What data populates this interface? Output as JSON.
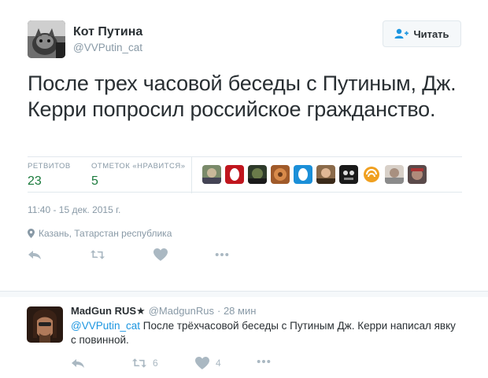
{
  "tweet": {
    "author_name": "Кот Путина",
    "author_handle": "@VVPutin_cat",
    "follow_label": "Читать",
    "text": "После трех часовой беседы с Путиным, Дж. Керри попросил российское гражданство.",
    "stats": {
      "retweets_label": "РЕТВИТОВ",
      "retweets_value": "23",
      "likes_label": "ОТМЕТОК «НРАВИТСЯ»",
      "likes_value": "5"
    },
    "timestamp": "11:40 - 15 дек. 2015 г.",
    "location": "Казань, Татарстан республика"
  },
  "reply": {
    "author_name": "MadGun RUS★",
    "author_handle": "@MadgunRus",
    "time": "· 28 мин",
    "mention": "@VVPutin_cat",
    "text": " После трёхчасовой беседы с Путиным Дж. Керри написал явку с повинной.",
    "retweet_count": "6",
    "like_count": "4"
  },
  "colors": {
    "accent": "#1b95e0",
    "stat_value": "#1a7a3c",
    "muted": "#8899a6",
    "icon": "#aab8c2"
  },
  "icons": [
    "follow-icon",
    "location-pin-icon",
    "reply-icon",
    "retweet-icon",
    "like-icon",
    "more-icon"
  ]
}
